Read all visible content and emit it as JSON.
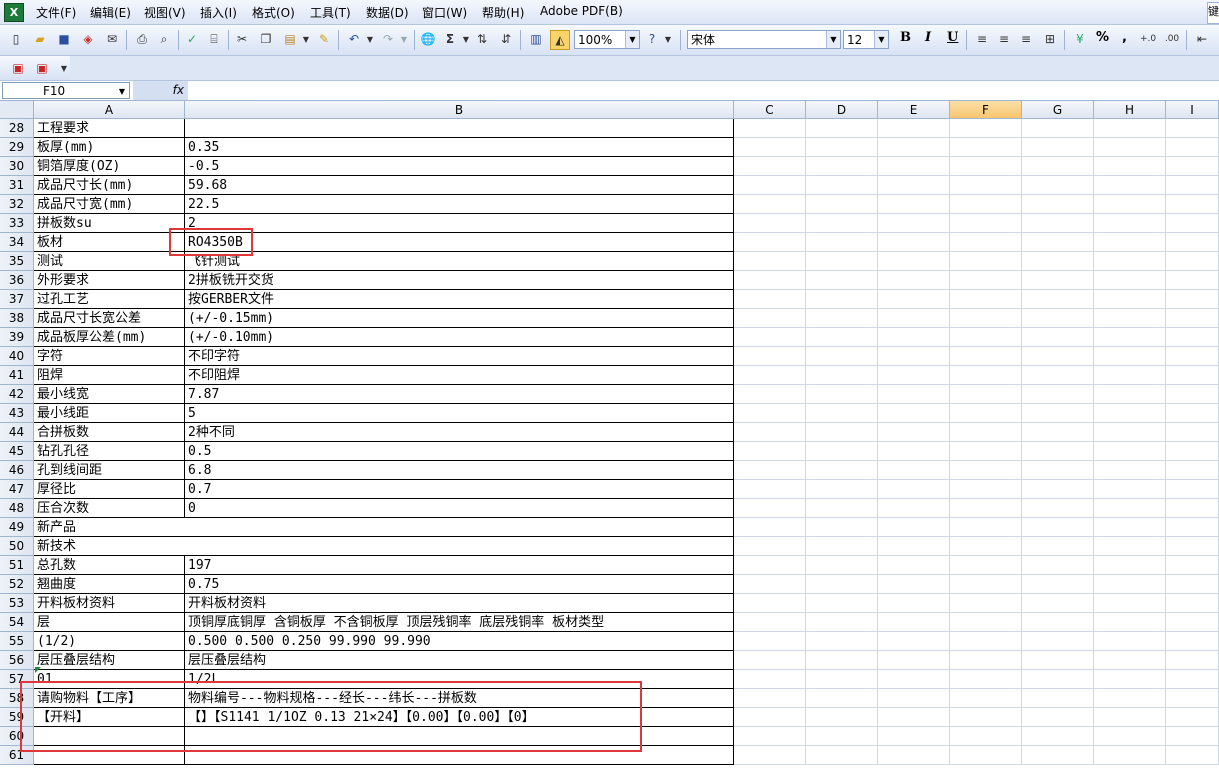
{
  "menu": [
    "文件(F)",
    "编辑(E)",
    "视图(V)",
    "插入(I)",
    "格式(O)",
    "工具(T)",
    "数据(D)",
    "窗口(W)",
    "帮助(H)",
    "Adobe PDF(B)"
  ],
  "help_box": "键",
  "toolbar": {
    "zoom": "100%",
    "font": "宋体",
    "font_size": "12",
    "bold": "B",
    "italic": "I",
    "underline": "U",
    "percent": "%",
    "comma": ","
  },
  "namebox": "F10",
  "fx": "fx",
  "columns": [
    "A",
    "B",
    "C",
    "D",
    "E",
    "F",
    "G",
    "H",
    "I"
  ],
  "rows": [
    {
      "num": "28",
      "a": "工程要求",
      "b": ""
    },
    {
      "num": "29",
      "a": "板厚(mm)",
      "b": "0.35"
    },
    {
      "num": "30",
      "a": "铜箔厚度(OZ)",
      "b": "-0.5"
    },
    {
      "num": "31",
      "a": "成品尺寸长(mm)",
      "b": "59.68"
    },
    {
      "num": "32",
      "a": "成品尺寸宽(mm)",
      "b": "22.5"
    },
    {
      "num": "33",
      "a": "拼板数su",
      "b": "2"
    },
    {
      "num": "34",
      "a": "板材",
      "b": "RO4350B"
    },
    {
      "num": "35",
      "a": "测试",
      "b": "飞针测试"
    },
    {
      "num": "36",
      "a": "外形要求",
      "b": "2拼板铣开交货"
    },
    {
      "num": "37",
      "a": "过孔工艺",
      "b": "按GERBER文件"
    },
    {
      "num": "38",
      "a": "成品尺寸长宽公差",
      "b": "(+/-0.15mm)"
    },
    {
      "num": "39",
      "a": "成品板厚公差(mm)",
      "b": "(+/-0.10mm)"
    },
    {
      "num": "40",
      "a": "字符",
      "b": "不印字符"
    },
    {
      "num": "41",
      "a": "阻焊",
      "b": "不印阻焊"
    },
    {
      "num": "42",
      "a": "最小线宽",
      "b": "7.87"
    },
    {
      "num": "43",
      "a": "最小线距",
      "b": "5"
    },
    {
      "num": "44",
      "a": "合拼板数",
      "b": "2种不同"
    },
    {
      "num": "45",
      "a": "钻孔孔径",
      "b": "0.5"
    },
    {
      "num": "46",
      "a": "孔到线间距",
      "b": "6.8"
    },
    {
      "num": "47",
      "a": "厚径比",
      "b": "0.7"
    },
    {
      "num": "48",
      "a": "压合次数",
      "b": "0"
    },
    {
      "num": "49",
      "a": "新产品",
      "b": "",
      "span": true
    },
    {
      "num": "50",
      "a": "新技术",
      "b": "",
      "span": true
    },
    {
      "num": "51",
      "a": "总孔数",
      "b": "197"
    },
    {
      "num": "52",
      "a": "翘曲度",
      "b": "0.75"
    },
    {
      "num": "53",
      "a": "开料板材资料",
      "b": "开料板材资料"
    },
    {
      "num": "54",
      "a": "层",
      "b": "顶铜厚底铜厚 含铜板厚 不含铜板厚 顶层残铜率 底层残铜率 板材类型"
    },
    {
      "num": "55",
      "a": "(1/2)",
      "b": "0.500  0.500           0.250       99.990     99.990"
    },
    {
      "num": "56",
      "a": "层压叠层结构",
      "b": "层压叠层结构"
    },
    {
      "num": "57",
      "a": "01",
      "b": "1/2L"
    },
    {
      "num": "58",
      "a": "请购物料【工序】",
      "b": "物料编号---物料规格---经长---纬长---拼板数"
    },
    {
      "num": "59",
      "a": "【开料】",
      "b": "【】【S1141 1/1OZ 0.13 21×24】【0.00】【0.00】【0】"
    },
    {
      "num": "60",
      "a": "",
      "b": ""
    },
    {
      "num": "61",
      "a": "",
      "b": ""
    }
  ]
}
